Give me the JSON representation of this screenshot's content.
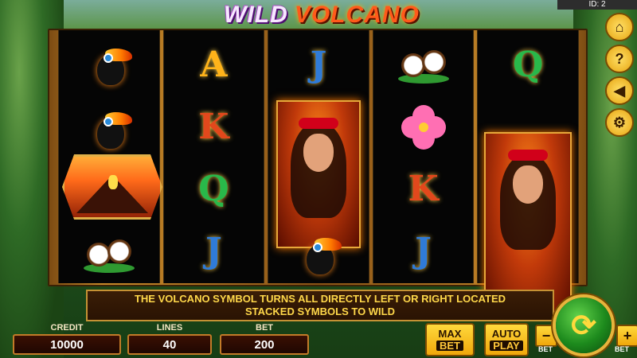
{
  "header": {
    "logo_wild": "WILD",
    "logo_volcano": "VOLCANO",
    "id_label": "ID: 2"
  },
  "reels": [
    [
      "toucan",
      "toucan",
      "volcano",
      "coconut"
    ],
    [
      "A",
      "K",
      "Q",
      "J"
    ],
    [
      "J",
      "girl",
      "girl",
      "toucan"
    ],
    [
      "coconut",
      "hibiscus",
      "K",
      "J"
    ],
    [
      "Q",
      "girl",
      "girl",
      "girl"
    ]
  ],
  "letters": {
    "r2c1": "A",
    "r2c2": "K",
    "r2c3": "Q",
    "r2c4": "J",
    "r3c1": "J",
    "r4c3": "K",
    "r4c4": "J",
    "r5c1": "Q"
  },
  "info": {
    "line1": "THE VOLCANO SYMBOL TURNS ALL DIRECTLY LEFT OR RIGHT LOCATED",
    "line2": "STACKED SYMBOLS TO WILD"
  },
  "controls": {
    "credit_label": "CREDIT",
    "credit_value": "10000",
    "lines_label": "LINES",
    "lines_value": "40",
    "bet_label": "BET",
    "bet_value": "200",
    "max_top": "MAX",
    "max_bottom": "BET",
    "auto_top": "AUTO",
    "auto_bottom": "PLAY",
    "minus": "−",
    "plus": "+",
    "minus_tag": "BET",
    "plus_tag": "BET"
  },
  "side_icons": [
    "home-icon",
    "help-icon",
    "sound-icon",
    "gear-icon"
  ],
  "colors": {
    "accent_gold": "#ffb31a",
    "spin_green": "#1d8a1d",
    "info_text": "#ffd84a"
  }
}
